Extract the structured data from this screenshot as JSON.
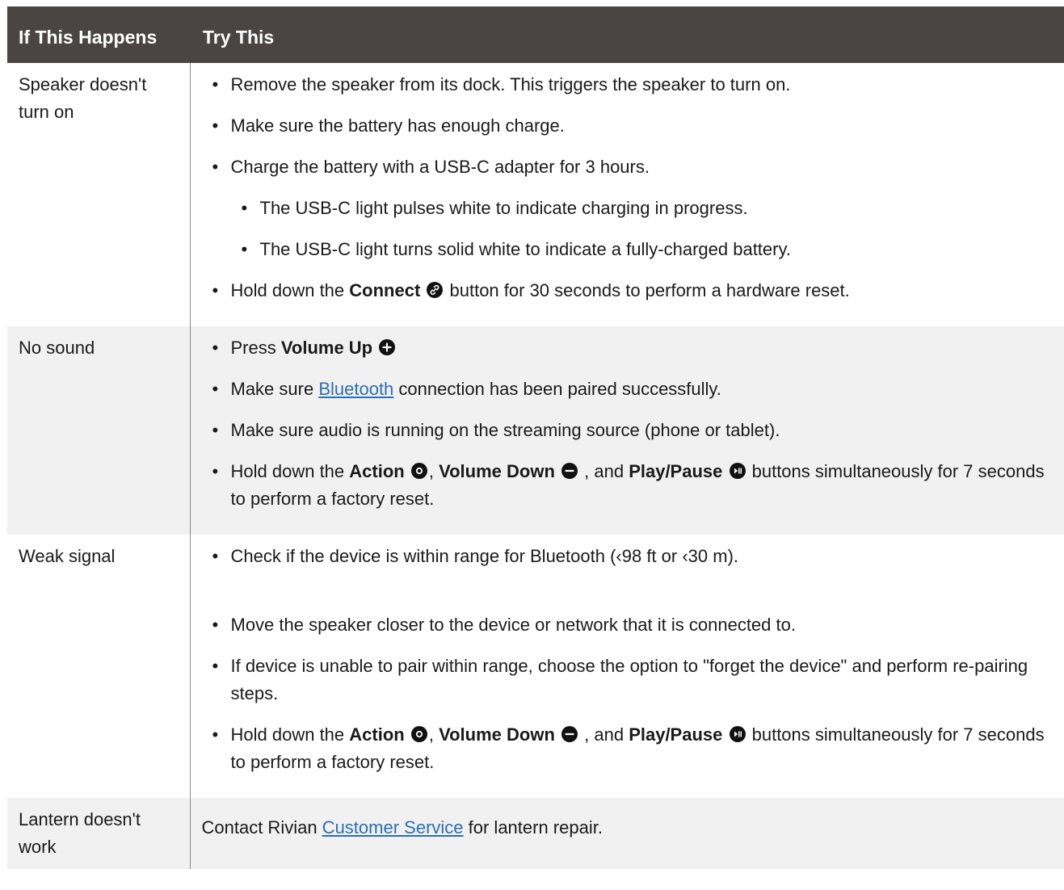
{
  "header": {
    "col1": "If This Happens",
    "col2": "Try This"
  },
  "rows": [
    {
      "condition": "Speaker doesn't turn on",
      "steps": [
        "Remove the speaker from its dock. This triggers the speaker to turn on.",
        "Make sure the battery has enough charge.",
        "Charge the battery with a USB-C adapter for 3 hours.",
        "The USB-C light pulses white to indicate charging in progress.",
        "The USB-C light turns solid white to indicate a fully-charged battery."
      ],
      "reset": {
        "pre": "Hold down the ",
        "bold": "Connect",
        "post": " button for 30 seconds to perform a hardware reset."
      }
    },
    {
      "condition": "No sound",
      "volume": {
        "pre": "Press ",
        "bold": "Volume Up"
      },
      "bt": {
        "pre": "Make sure ",
        "link": "Bluetooth",
        "post": " connection has been paired successfully."
      },
      "audio": "Make sure audio is running on the streaming source (phone or tablet).",
      "factory": {
        "pre": "Hold down the ",
        "action": "Action",
        "comma": ", ",
        "voldown": "Volume Down",
        "and": " , and ",
        "play": "Play/Pause",
        "post": " buttons simultaneously for 7 seconds to perform a factory reset."
      }
    },
    {
      "condition": "Weak signal",
      "steps": [
        "Check if the device is within range for Bluetooth (‹98 ft or ‹30 m).",
        "Move the speaker closer to the device or network that it is connected to.",
        "If device is unable to pair within range, choose the option to \"forget the device\" and perform re-pairing steps."
      ],
      "factory": {
        "pre": "Hold down the ",
        "action": "Action",
        "comma": ", ",
        "voldown": "Volume Down",
        "and": " , and ",
        "play": "Play/Pause",
        "post": " buttons simultaneously for 7 seconds to perform a factory reset."
      }
    },
    {
      "condition": "Lantern doesn't work",
      "contact": {
        "pre": "Contact Rivian ",
        "link": "Customer Service",
        "post": " for lantern repair."
      }
    }
  ],
  "icons": [
    "link-icon",
    "plus-circle-icon",
    "action-dot-icon",
    "minus-circle-icon",
    "play-pause-icon"
  ]
}
